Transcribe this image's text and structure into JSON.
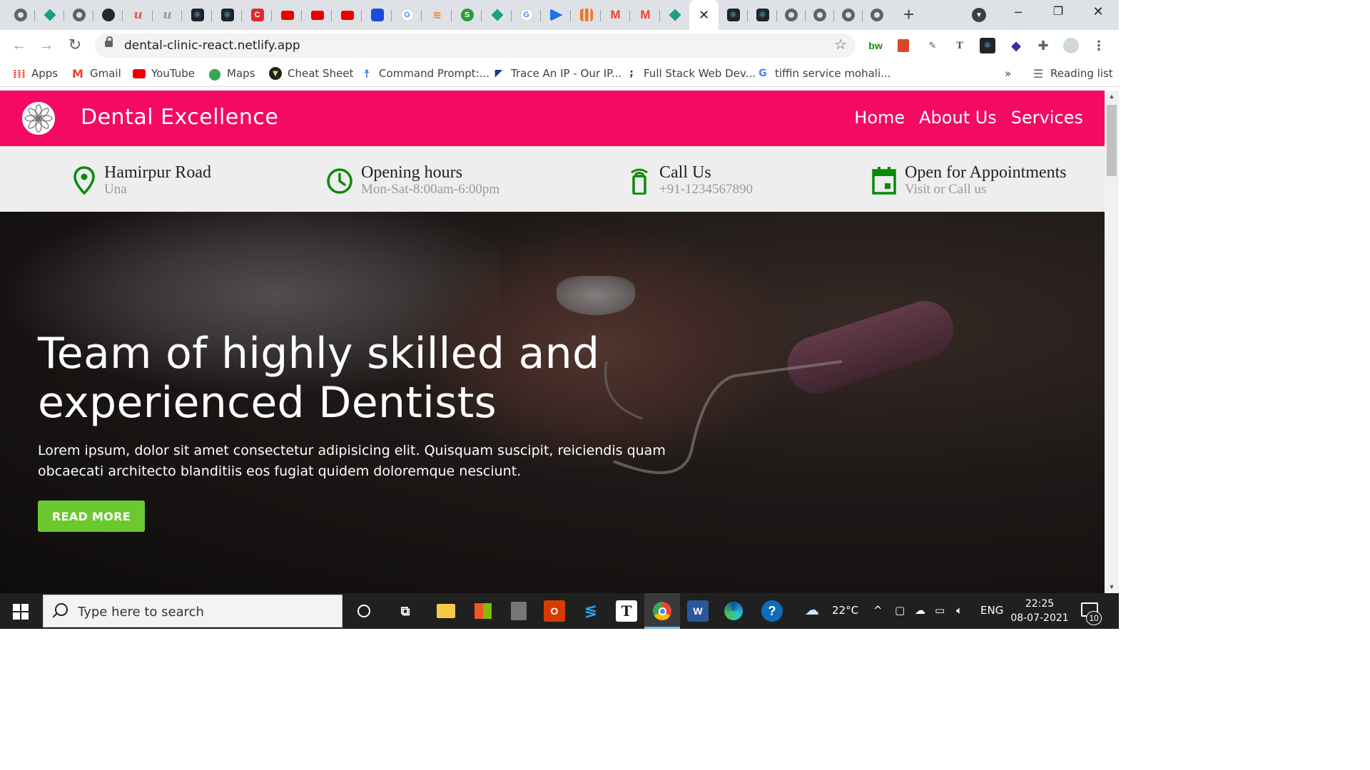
{
  "browser": {
    "tabs": [
      {
        "icon": "globe-icon"
      },
      {
        "icon": "diamond-icon"
      },
      {
        "icon": "globe-icon"
      },
      {
        "icon": "github-icon"
      },
      {
        "icon": "udemy-icon"
      },
      {
        "icon": "udemy-gray-icon"
      },
      {
        "icon": "react-icon"
      },
      {
        "icon": "react-icon"
      },
      {
        "icon": "c-logo-icon"
      },
      {
        "icon": "youtube-icon"
      },
      {
        "icon": "youtube-icon"
      },
      {
        "icon": "youtube-icon"
      },
      {
        "icon": "chart-icon"
      },
      {
        "icon": "google-icon"
      },
      {
        "icon": "stackoverflow-icon"
      },
      {
        "icon": "s-logo-icon"
      },
      {
        "icon": "diamond-icon"
      },
      {
        "icon": "google-icon"
      },
      {
        "icon": "blue-arrow-icon"
      },
      {
        "icon": "bars-icon"
      },
      {
        "icon": "gmail-icon"
      },
      {
        "icon": "gmail-icon"
      },
      {
        "icon": "diamond-icon"
      },
      {
        "icon": "close-icon",
        "active": true
      },
      {
        "icon": "react-icon"
      },
      {
        "icon": "react-icon"
      },
      {
        "icon": "globe-icon"
      },
      {
        "icon": "globe-icon"
      },
      {
        "icon": "globe-icon"
      },
      {
        "icon": "globe-icon"
      }
    ],
    "url": "dental-clinic-react.netlify.app",
    "extensions": [
      "bw",
      "book",
      "pen",
      "T",
      "react",
      "puzzle-3",
      "puzzle",
      "avatar",
      "menu"
    ],
    "bookmarks": [
      {
        "label": "Apps",
        "icon": "apps-grid-icon"
      },
      {
        "label": "Gmail",
        "icon": "gmail-icon"
      },
      {
        "label": "YouTube",
        "icon": "youtube-icon"
      },
      {
        "label": "Maps",
        "icon": "maps-pin-icon"
      },
      {
        "label": "Cheat Sheet",
        "icon": "cheat-sheet-icon"
      },
      {
        "label": "Command Prompt:...",
        "icon": "accessibility-icon"
      },
      {
        "label": "Trace An IP - Our IP...",
        "icon": "trace-ip-icon"
      },
      {
        "label": "Full Stack Web Dev...",
        "icon": "dots-icon"
      },
      {
        "label": "tiffin service mohali...",
        "icon": "google-icon"
      }
    ],
    "bookmarks_more": "»",
    "reading_list": "Reading list"
  },
  "site": {
    "brand": "Dental Excellence",
    "nav": [
      "Home",
      "About Us",
      "Services"
    ],
    "colors": {
      "header": "#f50a63",
      "accent_green": "#008000",
      "button": "#6bc92f"
    },
    "info": [
      {
        "title": "Hamirpur Road",
        "sub": "Una",
        "icon": "location-pin-icon"
      },
      {
        "title": "Opening hours",
        "sub": "Mon-Sat-8:00am-6:00pm",
        "icon": "clock-icon"
      },
      {
        "title": "Call Us",
        "sub": "+91-1234567890",
        "icon": "phone-icon"
      },
      {
        "title": "Open for Appointments",
        "sub": "Visit or Call us",
        "icon": "calendar-icon"
      }
    ],
    "hero": {
      "heading_line1": "Team of highly skilled and",
      "heading_line2": "experienced Dentists",
      "text": "Lorem ipsum, dolor sit amet consectetur adipisicing elit. Quisquam suscipit, reiciendis quam obcaecati architecto blanditiis eos fugiat quidem doloremque nesciunt.",
      "button": "READ MORE"
    }
  },
  "taskbar": {
    "search_placeholder": "Type here to search",
    "weather": "22°C",
    "language": "ENG",
    "time": "22:25",
    "date": "08-07-2021",
    "notifications": "10"
  }
}
